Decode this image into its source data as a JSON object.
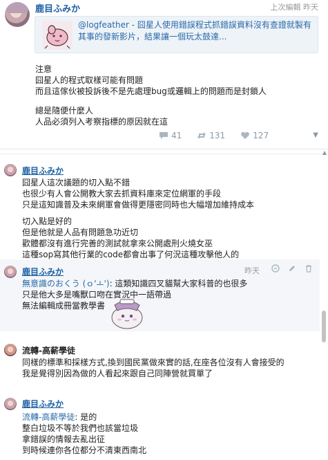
{
  "post": {
    "author": "鹿目ふみか",
    "meta": "上次編輯 昨天",
    "link_card": {
      "handle": "@logfeather",
      "title_rest": " - 囧星人使用錯誤程式抓錯誤資料沒有查證就製有其事的發新影片，結果讓一個玩太鼓達..."
    },
    "body_lines_1": [
      "注意",
      "囧星人的程式取樣可能有問題",
      "而且這傢伙被投訴後不是先處理bug或邏輯上的問題而是封鎖人"
    ],
    "body_lines_2": [
      "總是隨便什麼人",
      "人品必須列入考察指標的原因就在這"
    ],
    "stats": {
      "comments": "41",
      "reshares": "131",
      "likes": "127"
    }
  },
  "comments": [
    {
      "author": "鹿目ふみか",
      "lines_1": [
        "囧星人這次議題的切入點不錯",
        "也很少有人會公開教大家去抓資料庫來定位網軍的手段",
        "只是這知識普及未來網軍會做得更隱密同時也大幅增加維持成本"
      ],
      "lines_2": [
        "切入點是好的",
        "但是他就是人品有問題急功近切",
        "歡體都沒有進行完善的測試就拿來公開處刑火燒女巫",
        "這種sop寫其他行業的code都會出事了何況這種攻擊他人的"
      ]
    },
    {
      "author": "鹿目ふみか",
      "time": "昨天",
      "mention": "無意識のおくう (ｏ'ㅗ')",
      "line_1_rest": ": 這類知識四叉貓幫大家科普的也很多",
      "lines": [
        "只是他大多是嘴獸口吻在實況中一語帶過",
        "無法編輯成冊當教學書"
      ]
    },
    {
      "author": "流轉-高薪學徒",
      "lines": [
        "同樣的標準和採樣方式,換到國民黨做來實的話,在座各位沒有人會接受的",
        "我是覺得別因為做的人看起來跟自己同陣營就買單了"
      ]
    },
    {
      "author": "鹿目ふみか",
      "mention": "流轉-高薪學徒",
      "line_1_rest": ": 是的",
      "lines": [
        "整白垃圾不等於我們也該當垃圾",
        "拿錯誤的情報去亂出征",
        "到時候連你各位都分不清東西南北"
      ]
    }
  ],
  "icons": {
    "comment": "speech-bubble-icon",
    "reshare": "reshare-icon",
    "like": "heart-icon",
    "menu": "caret-down-icon"
  },
  "colors": {
    "link": "#2a6aa8",
    "author": "#1b5fa3",
    "muted": "#8c9aa7",
    "card_bg": "#eef3f8"
  }
}
